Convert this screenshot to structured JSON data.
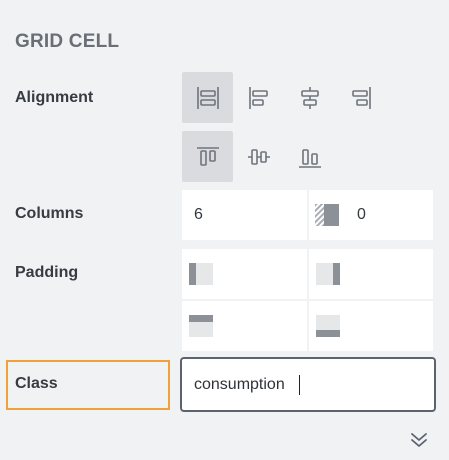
{
  "panel": {
    "title": "GRID CELL"
  },
  "alignment": {
    "label": "Alignment",
    "horizontal": [
      {
        "icon": "justify-stretch-icon",
        "active": true
      },
      {
        "icon": "justify-start-icon",
        "active": false
      },
      {
        "icon": "justify-center-icon",
        "active": false
      },
      {
        "icon": "justify-end-icon",
        "active": false
      }
    ],
    "vertical": [
      {
        "icon": "align-top-icon",
        "active": true
      },
      {
        "icon": "align-middle-icon",
        "active": false
      },
      {
        "icon": "align-bottom-icon",
        "active": false
      }
    ]
  },
  "columns": {
    "label": "Columns",
    "span_value": "6",
    "offset_icon": "column-offset-icon",
    "offset_value": "0"
  },
  "padding": {
    "label": "Padding",
    "left_icon": "padding-left-icon",
    "right_icon": "padding-right-icon",
    "top_icon": "padding-top-icon",
    "bottom_icon": "padding-bottom-icon"
  },
  "class_field": {
    "label": "Class",
    "value": "consumption"
  },
  "footer": {
    "expand_icon": "double-chevron-down-icon"
  },
  "colors": {
    "accent_highlight": "#f0a23a",
    "active_button_bg": "#d9dbdf",
    "icon_gray": "#6f747c"
  }
}
